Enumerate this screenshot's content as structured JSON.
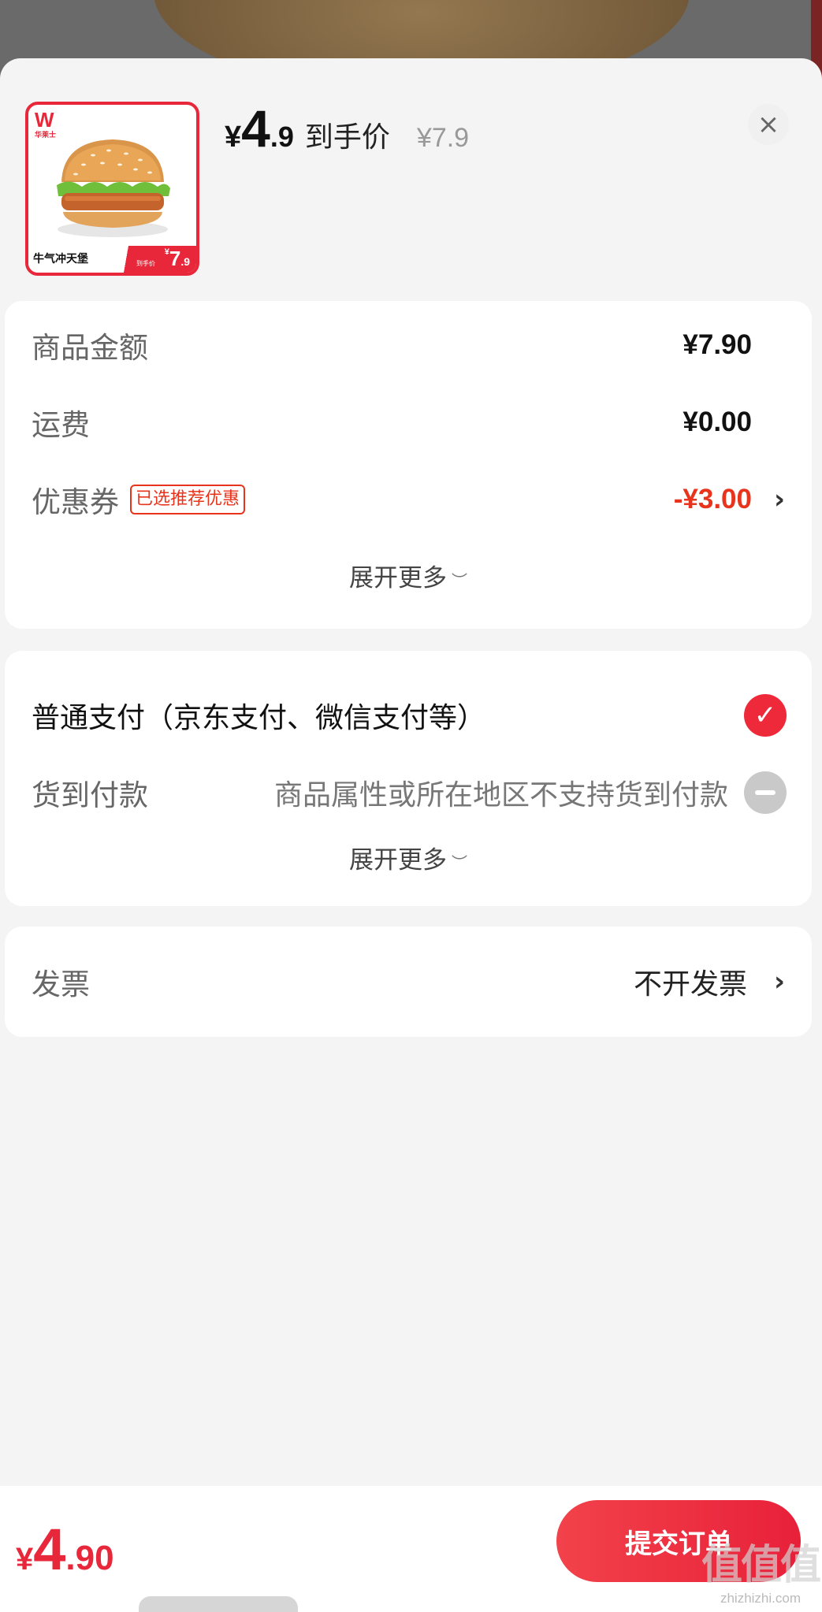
{
  "product": {
    "thumb_brand": "W",
    "thumb_brand_sub": "华莱士",
    "thumb_name": "牛气冲天堡",
    "thumb_price_sub": "到手价",
    "thumb_price_yen": "¥",
    "thumb_price_int": "7",
    "thumb_price_dec": ".9"
  },
  "header": {
    "price_yen": "¥",
    "price_int": "4",
    "price_dec": ".9",
    "price_label": "到手价",
    "original_price": "¥7.9",
    "close_icon": "close-icon"
  },
  "summary": {
    "goods_label": "商品金额",
    "goods_value": "¥7.90",
    "shipping_label": "运费",
    "shipping_value": "¥0.00",
    "coupon_label": "优惠券",
    "coupon_tag": "已选推荐优惠",
    "coupon_value": "-¥3.00",
    "expand_label": "展开更多"
  },
  "payment": {
    "normal_label": "普通支付（京东支付、微信支付等）",
    "normal_selected": true,
    "cod_label": "货到付款",
    "cod_note": "商品属性或所在地区不支持货到付款",
    "cod_selected": false,
    "expand_label": "展开更多"
  },
  "invoice": {
    "label": "发票",
    "value": "不开发票"
  },
  "footer": {
    "total_yen": "¥",
    "total_int": "4",
    "total_dec": ".90",
    "submit_label": "提交订单",
    "watermark_big": "值值值",
    "watermark_small": "zhizhizhi.com"
  },
  "colors": {
    "accent": "#e8283a",
    "discount": "#e8341c",
    "background": "#f4f4f4"
  }
}
